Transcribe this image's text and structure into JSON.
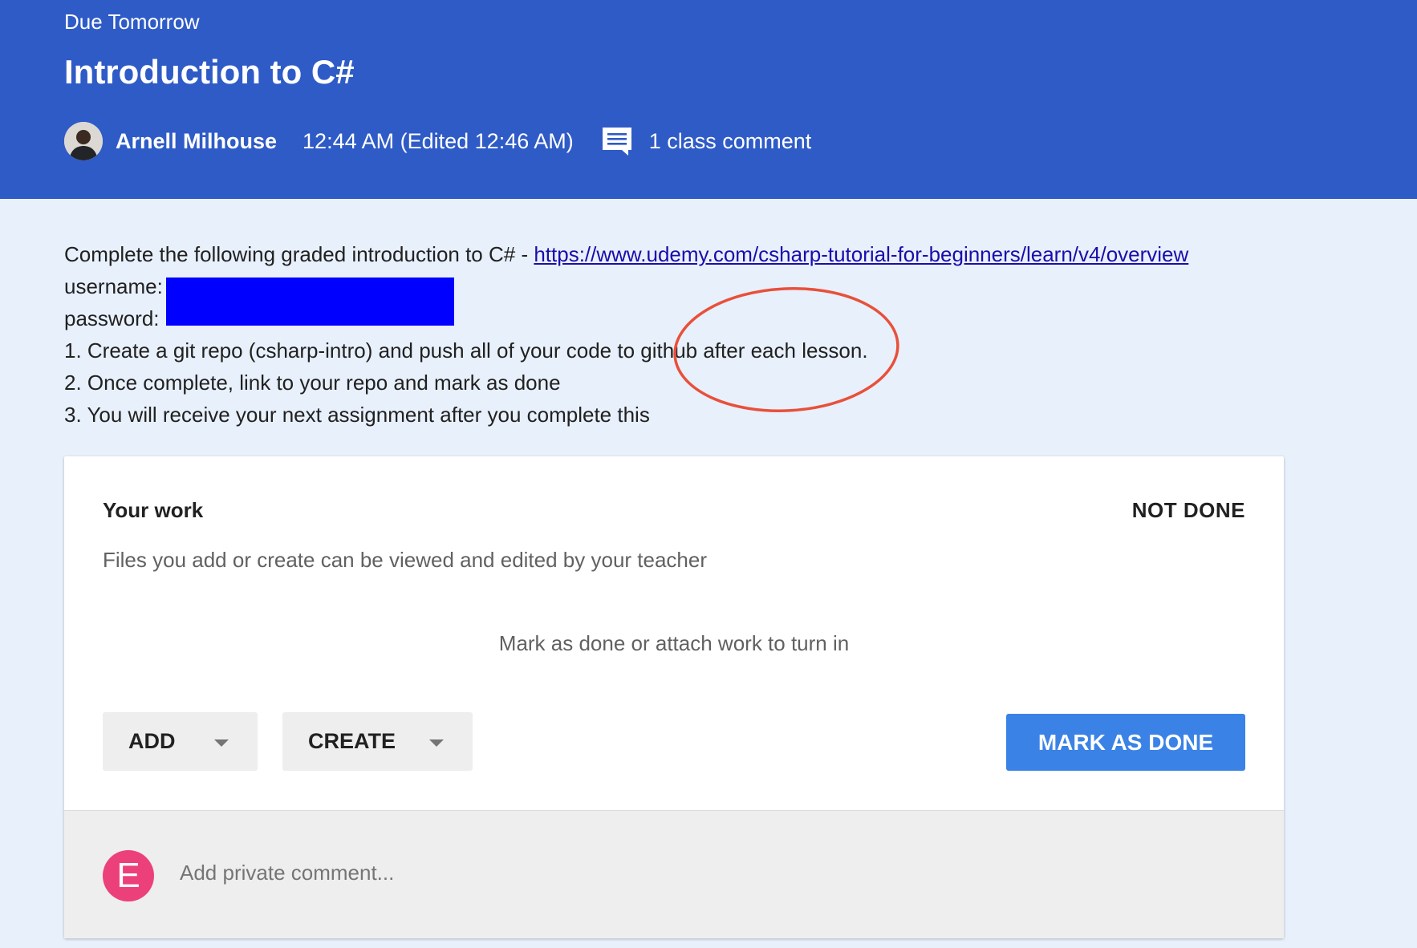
{
  "colors": {
    "header_bg": "#2f5bc7",
    "page_bg": "#e8f0fb",
    "primary_button": "#3b82e6",
    "annotation_circle": "#e8503a",
    "private_avatar": "#ec407a",
    "redaction": "#0000ff"
  },
  "header": {
    "due_label": "Due Tomorrow",
    "title": "Introduction to C#",
    "author": "Arnell Milhouse",
    "timestamp": "12:44 AM (Edited 12:46 AM)",
    "comments_label": "1 class comment",
    "comment_icon": "comment-icon"
  },
  "instructions": {
    "intro_text": "Complete the following graded introduction to C# - ",
    "link": "https://www.udemy.com/csharp-tutorial-for-beginners/learn/v4/overview",
    "username_label": "username:",
    "password_label": "password:",
    "steps": [
      "1. Create a git repo (csharp-intro) and push all of your code to github after each lesson.",
      "2. Once complete, link to your repo and mark as done",
      "3. You will receive your next assignment after you complete this"
    ]
  },
  "work": {
    "heading": "Your work",
    "status": "NOT DONE",
    "description": "Files you add or create can be viewed and edited by your teacher",
    "hint": "Mark as done or attach work to turn in",
    "add_label": "ADD",
    "create_label": "CREATE",
    "mark_done_label": "MARK AS DONE"
  },
  "private_comment": {
    "avatar_letter": "E",
    "placeholder": "Add private comment..."
  }
}
